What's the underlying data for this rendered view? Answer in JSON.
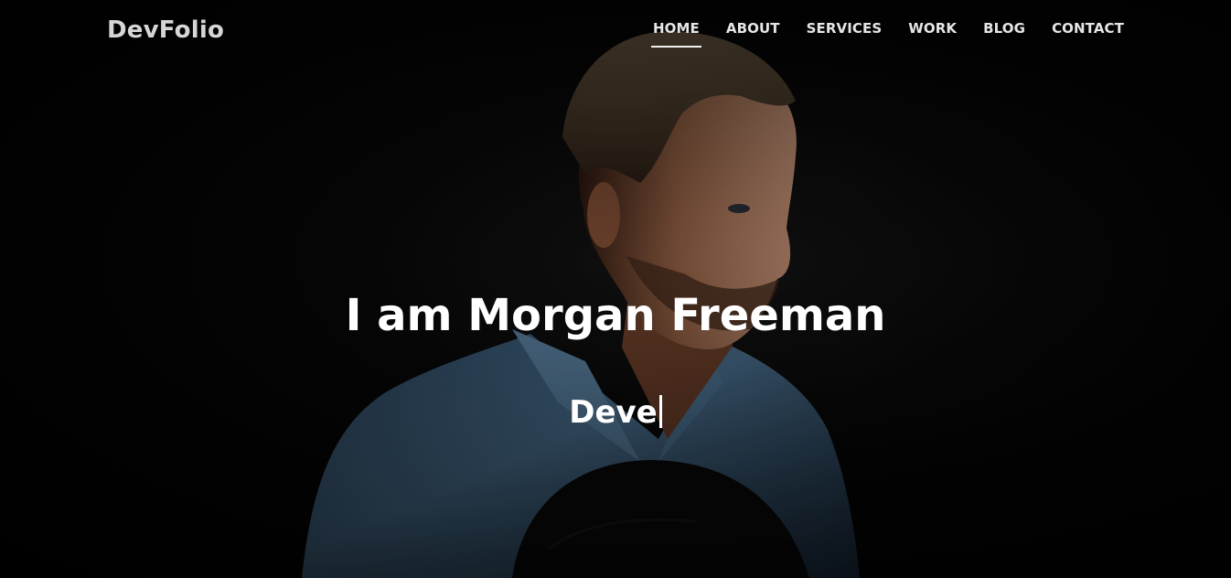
{
  "nav": {
    "brand": "DevFolio",
    "items": [
      {
        "label": "HOME",
        "active": true
      },
      {
        "label": "ABOUT",
        "active": false
      },
      {
        "label": "SERVICES",
        "active": false
      },
      {
        "label": "WORK",
        "active": false
      },
      {
        "label": "BLOG",
        "active": false
      },
      {
        "label": "CONTACT",
        "active": false
      }
    ]
  },
  "hero": {
    "title": "I am Morgan Freeman",
    "typed_text": "Deve"
  },
  "colors": {
    "background": "#050505",
    "text": "#ffffff",
    "brand": "#d6d6d6",
    "shirt": "#4a6e8e"
  }
}
